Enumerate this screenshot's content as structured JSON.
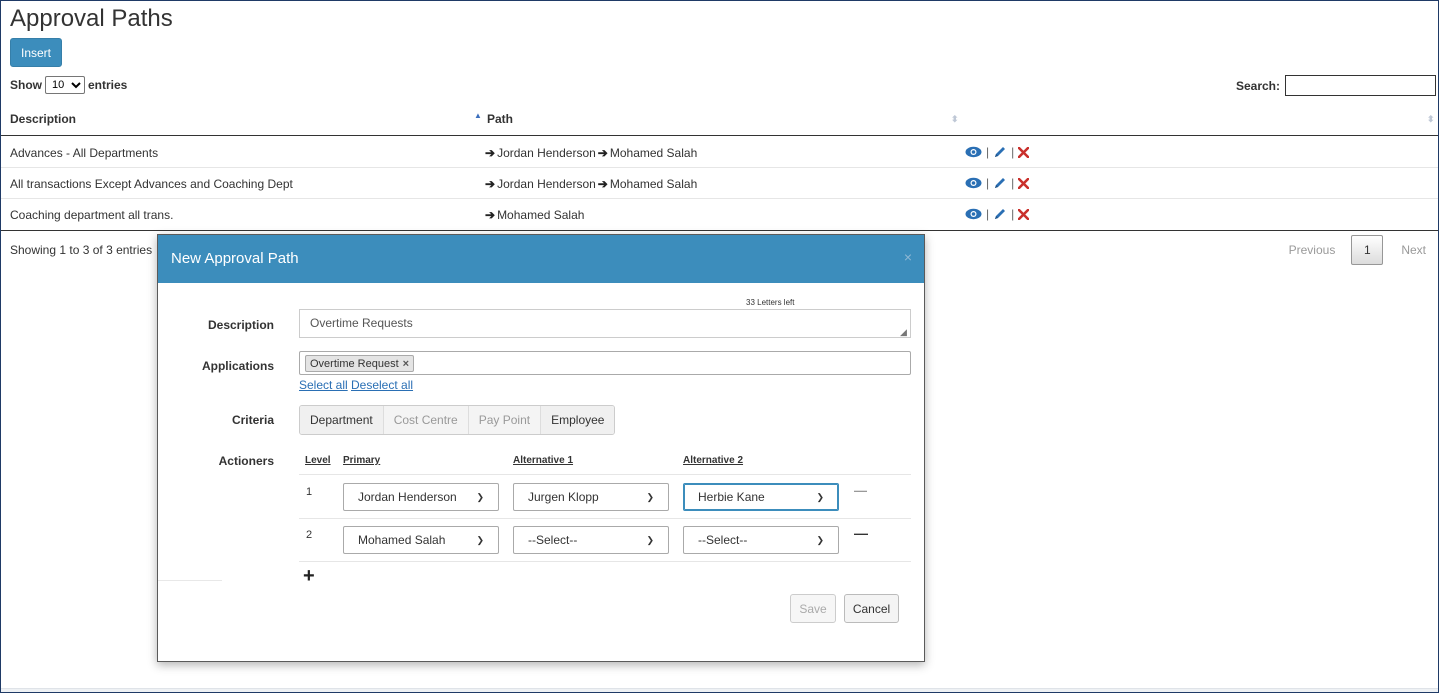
{
  "page": {
    "title": "Approval Paths",
    "insert_label": "Insert",
    "show_label": "Show",
    "entries_label": "entries",
    "page_size": "10",
    "search_label": "Search:",
    "search_value": ""
  },
  "table": {
    "headers": {
      "description": "Description",
      "path": "Path"
    },
    "rows": [
      {
        "description": "Advances - All Departments",
        "path": [
          "Jordan Henderson",
          "Mohamed Salah"
        ]
      },
      {
        "description": "All transactions Except Advances and Coaching Dept",
        "path": [
          "Jordan Henderson",
          "Mohamed Salah"
        ]
      },
      {
        "description": "Coaching department all trans.",
        "path": [
          "Mohamed Salah"
        ]
      }
    ],
    "info": "Showing 1 to 3 of 3 entries",
    "pager": {
      "previous": "Previous",
      "page": "1",
      "next": "Next"
    }
  },
  "modal": {
    "title": "New Approval Path",
    "close": "×",
    "labels": {
      "description": "Description",
      "applications": "Applications",
      "criteria": "Criteria",
      "actioners": "Actioners"
    },
    "letters_left": "33 Letters left",
    "description_value": "Overtime Requests",
    "application_chip": "Overtime Request",
    "chip_remove": "×",
    "select_all": "Select all",
    "deselect_all": "Deselect all",
    "criteria": [
      "Department",
      "Cost Centre",
      "Pay Point",
      "Employee"
    ],
    "actioner_headers": {
      "level": "Level",
      "primary": "Primary",
      "alt1": "Alternative 1",
      "alt2": "Alternative 2"
    },
    "actioners": [
      {
        "level": "1",
        "primary": "Jordan Henderson",
        "alt1": "Jurgen Klopp",
        "alt2": "Herbie Kane"
      },
      {
        "level": "2",
        "primary": "Mohamed Salah",
        "alt1": "--Select--",
        "alt2": "--Select--"
      }
    ],
    "save": "Save",
    "cancel": "Cancel"
  },
  "colors": {
    "accent": "#3c8dbc",
    "delete": "#c9302c"
  }
}
